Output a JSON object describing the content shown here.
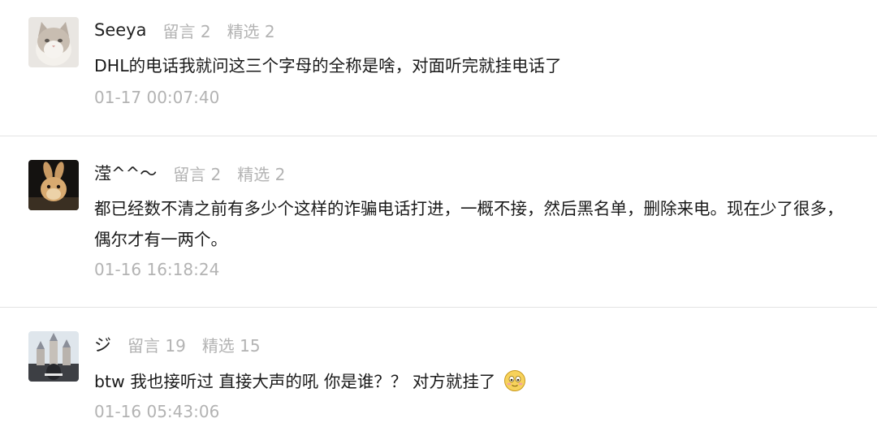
{
  "comments": [
    {
      "username": "Seeya",
      "messages_label": "留言 2",
      "featured_label": "精选 2",
      "text": "DHL的电话我就问这三个字母的全称是啥，对面听完就挂电话了",
      "timestamp": "01-17 00:07:40",
      "avatar_icon": "cat-avatar"
    },
    {
      "username": "滢^^～",
      "messages_label": "留言 2",
      "featured_label": "精选 2",
      "text": "都已经数不清之前有多少个这样的诈骗电话打进，一概不接，然后黑名单，删除来电。现在少了很多，偶尔才有一两个。",
      "timestamp": "01-16 16:18:24",
      "avatar_icon": "rabbit-avatar"
    },
    {
      "username": "ジ",
      "messages_label": "留言 19",
      "featured_label": "精选 15",
      "text": "btw 我也接听过 直接大声的吼 你是谁？？ 对方就挂了",
      "timestamp": "01-16 05:43:06",
      "avatar_icon": "castle-avatar",
      "trailing_emoji": "smiling-face-emoji"
    }
  ],
  "colors": {
    "text_primary": "#1a1a1a",
    "text_muted": "#b3b3b3",
    "divider": "#e3e3e3"
  }
}
